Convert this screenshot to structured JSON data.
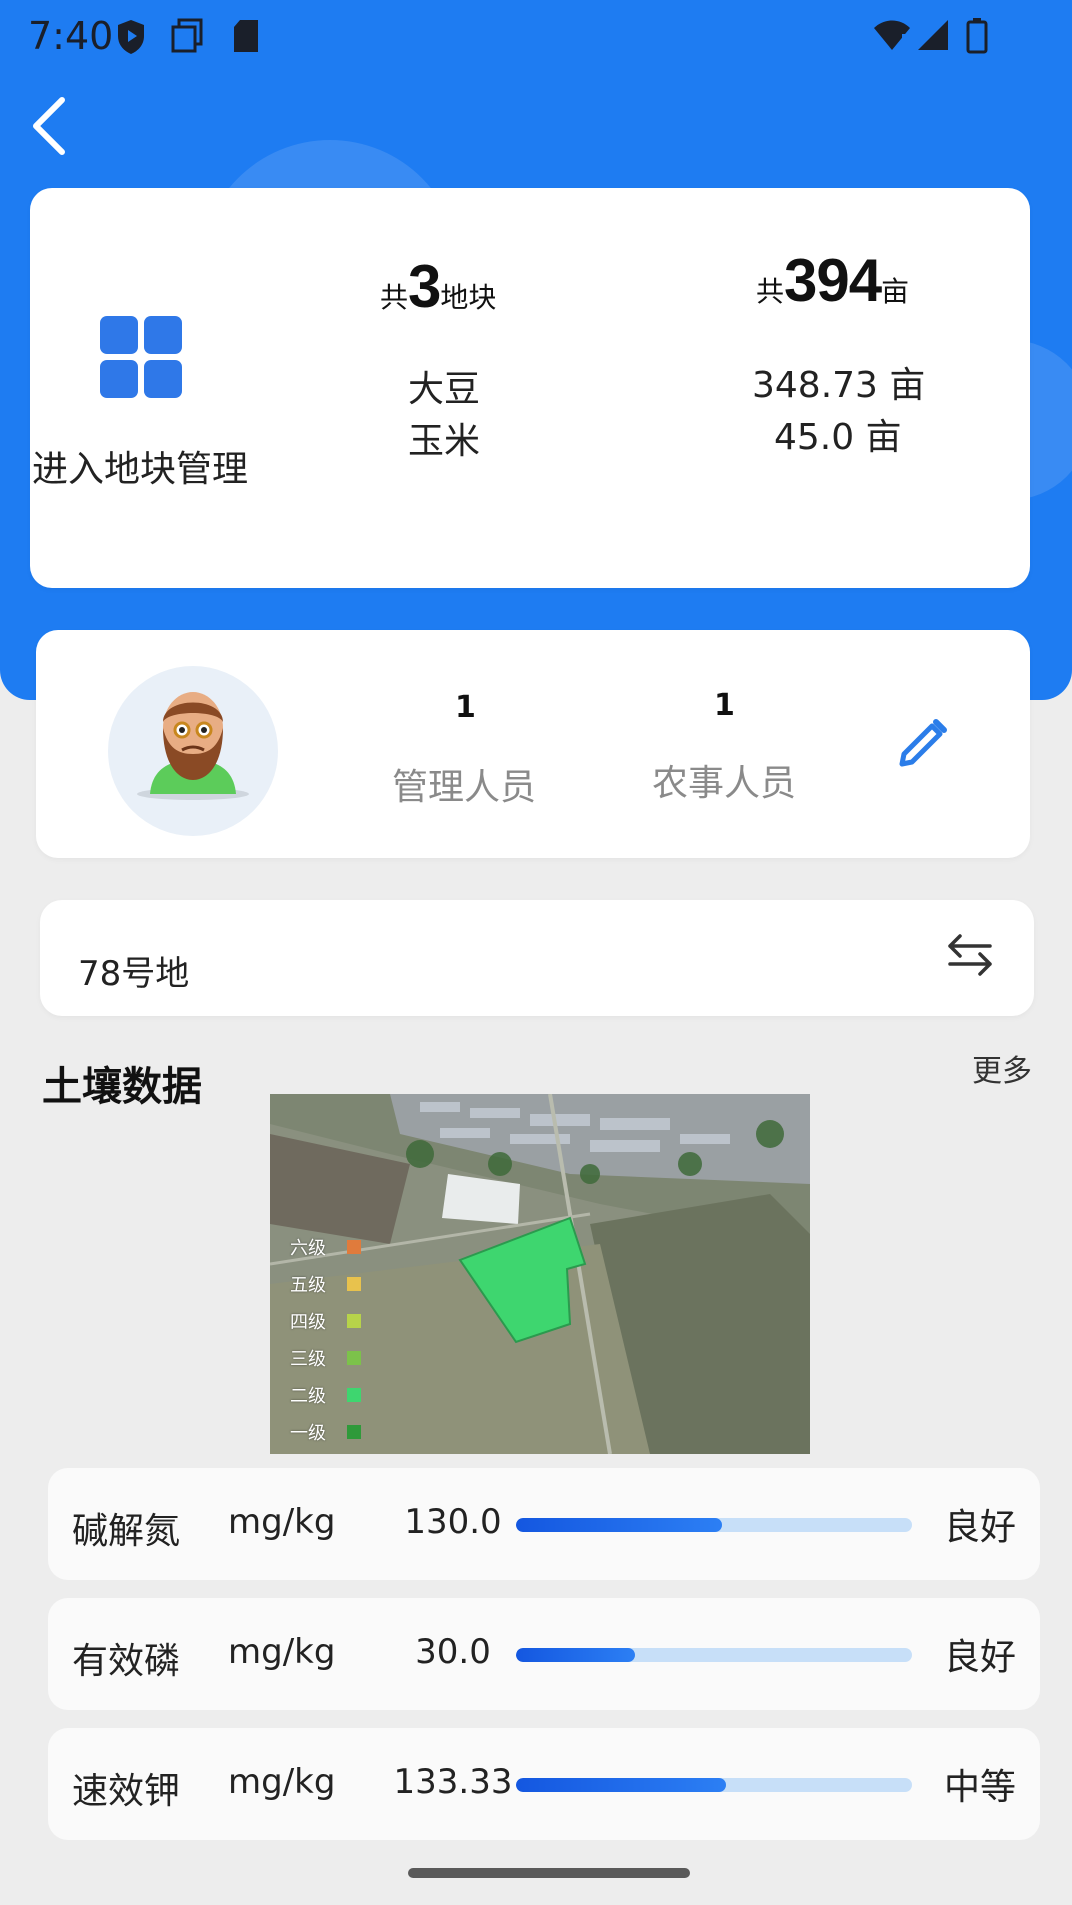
{
  "status_bar": {
    "time": "7:40",
    "icons": [
      "shield-icon",
      "copy-icon",
      "sd-card-icon",
      "wifi-icon",
      "signal-icon",
      "battery-icon"
    ]
  },
  "header": {
    "back_icon": "chevron-left-icon"
  },
  "summary": {
    "manage_label": "进入地块管理",
    "plots": {
      "prefix": "共",
      "count": "3",
      "suffix": "地块"
    },
    "area": {
      "prefix": "共",
      "total": "394",
      "suffix": "亩"
    },
    "crops": [
      {
        "name": "大豆",
        "area": "348.73 亩"
      },
      {
        "name": "玉米",
        "area": "45.0 亩"
      }
    ]
  },
  "staff": {
    "managers": {
      "count": "1",
      "label": "管理人员"
    },
    "farmhands": {
      "count": "1",
      "label": "农事人员"
    }
  },
  "plot_selector": {
    "value": "78号地"
  },
  "soil": {
    "title": "土壤数据",
    "more_label": "更多",
    "legend": [
      {
        "label": "六级",
        "color": "#e07b3c"
      },
      {
        "label": "五级",
        "color": "#e8c24d"
      },
      {
        "label": "四级",
        "color": "#b7d34a"
      },
      {
        "label": "三级",
        "color": "#7cc24a"
      },
      {
        "label": "二级",
        "color": "#3ed66f"
      },
      {
        "label": "一级",
        "color": "#2f9a3a"
      }
    ],
    "items": [
      {
        "name": "碱解氮",
        "unit": "mg/kg",
        "value": "130.0",
        "level": 0.52,
        "grade": "良好"
      },
      {
        "name": "有效磷",
        "unit": "mg/kg",
        "value": "30.0",
        "level": 0.3,
        "grade": "良好"
      },
      {
        "name": "速效钾",
        "unit": "mg/kg",
        "value": "133.33",
        "level": 0.53,
        "grade": "中等"
      }
    ]
  },
  "colors": {
    "brand_blue": "#1e7cf2",
    "progress_fill": "#1e6bef",
    "progress_track": "#c7dff8"
  }
}
